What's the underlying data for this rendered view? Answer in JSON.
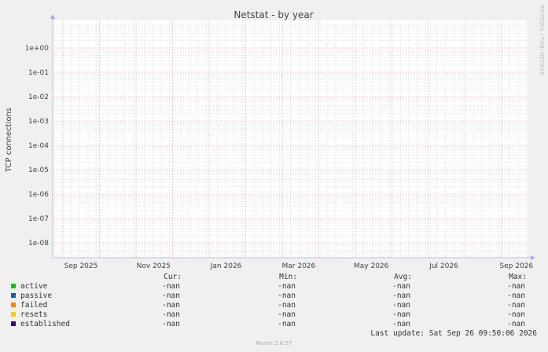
{
  "chart_data": {
    "type": "line",
    "title": "Netstat - by year",
    "ylabel": "TCP connections",
    "y_scale": "log",
    "ylim": [
      2e-09,
      10
    ],
    "y_ticks": [
      "1e+00",
      "1e-01",
      "1e-02",
      "1e-03",
      "1e-04",
      "1e-05",
      "1e-06",
      "1e-07",
      "1e-08"
    ],
    "x_ticks": [
      "Sep 2025",
      "Nov 2025",
      "Jan 2026",
      "Mar 2026",
      "May 2026",
      "Jul 2026",
      "Sep 2026"
    ],
    "grid": true,
    "series": [
      {
        "name": "active",
        "color": "#00cc00",
        "values": []
      },
      {
        "name": "passive",
        "color": "#0066b3",
        "values": []
      },
      {
        "name": "failed",
        "color": "#ff8000",
        "values": []
      },
      {
        "name": "resets",
        "color": "#ffcc00",
        "values": []
      },
      {
        "name": "established",
        "color": "#330099",
        "values": []
      }
    ]
  },
  "side_label": "RRDTOOL / TOBI OETIKER",
  "legend": {
    "headers": {
      "cur": "Cur:",
      "min": "Min:",
      "avg": "Avg:",
      "max": "Max:"
    },
    "rows": [
      {
        "name": "active",
        "cur": "-nan",
        "min": "-nan",
        "avg": "-nan",
        "max": "-nan"
      },
      {
        "name": "passive",
        "cur": "-nan",
        "min": "-nan",
        "avg": "-nan",
        "max": "-nan"
      },
      {
        "name": "failed",
        "cur": "-nan",
        "min": "-nan",
        "avg": "-nan",
        "max": "-nan"
      },
      {
        "name": "resets",
        "cur": "-nan",
        "min": "-nan",
        "avg": "-nan",
        "max": "-nan"
      },
      {
        "name": "established",
        "cur": "-nan",
        "min": "-nan",
        "avg": "-nan",
        "max": "-nan"
      }
    ]
  },
  "last_update": "Last update: Sat Sep 26 09:50:06 2026",
  "munin_version": "Munin 2.0.57"
}
